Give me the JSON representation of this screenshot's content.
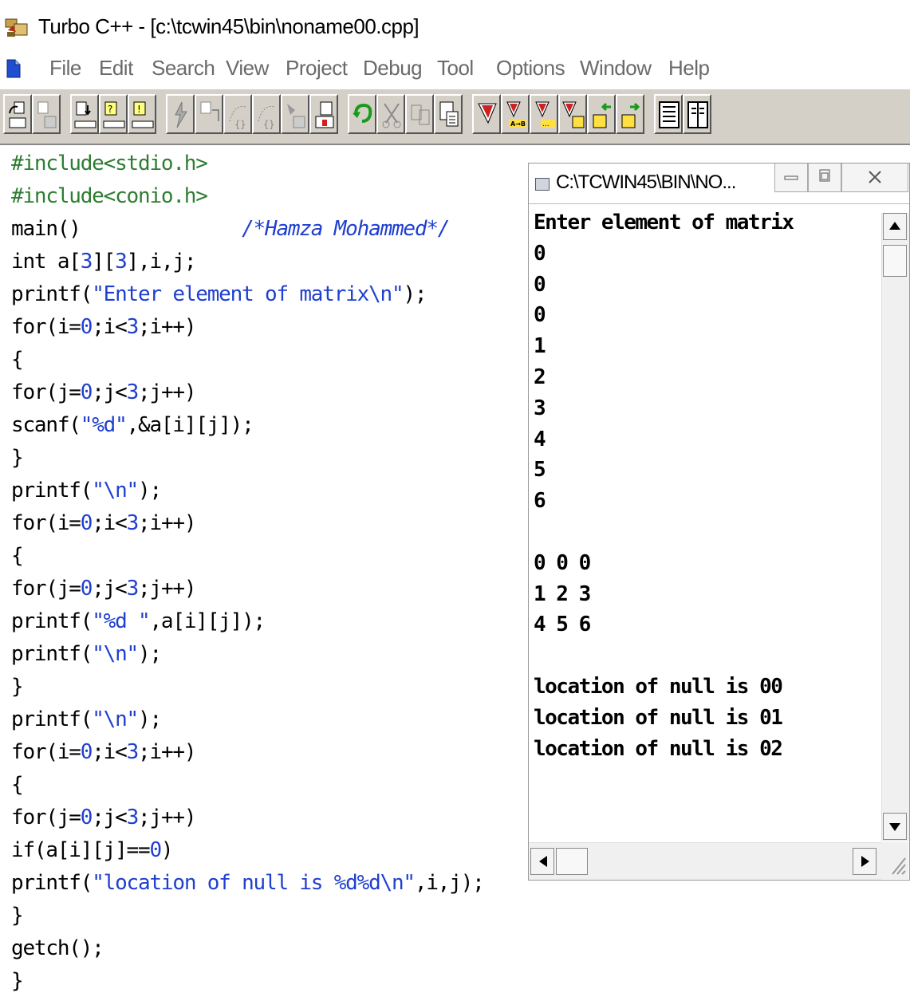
{
  "window": {
    "title": "Turbo C++ - [c:\\tcwin45\\bin\\noname00.cpp]",
    "icon": "turbo-cpp-app-icon"
  },
  "menu": {
    "doc_icon": "document-icon",
    "items": [
      "File",
      "Edit",
      "Search",
      "View",
      "Project",
      "Debug",
      "Tool",
      "Options",
      "Window",
      "Help"
    ]
  },
  "toolbar": {
    "buttons": [
      "open-project-icon",
      "save-project-icon",
      "compile-icon",
      "make-icon",
      "build-icon",
      "run-icon",
      "step-over-icon",
      "trace-into-icon",
      "breakpoint-icon",
      "inspect-icon",
      "undo-icon",
      "cut-icon",
      "copy-icon",
      "paste-icon",
      "search-icon",
      "replace-icon",
      "search-again-icon",
      "browse-icon",
      "previous-icon",
      "next-icon",
      "window-cascade-icon",
      "window-tile-icon"
    ]
  },
  "editor": {
    "lines": [
      [
        {
          "t": "#include<stdio.h>",
          "c": "pp"
        }
      ],
      [
        {
          "t": "#include<conio.h>",
          "c": "pp"
        }
      ],
      [
        {
          "t": "main()",
          "c": ""
        },
        {
          "t": "              /*Hamza Mohammed*/",
          "c": "cmt"
        }
      ],
      [
        {
          "t": "int a[",
          "c": ""
        },
        {
          "t": "3",
          "c": "num"
        },
        {
          "t": "][",
          "c": ""
        },
        {
          "t": "3",
          "c": "num"
        },
        {
          "t": "],i,j;",
          "c": ""
        }
      ],
      [
        {
          "t": "printf(",
          "c": ""
        },
        {
          "t": "\"Enter element of matrix\\n\"",
          "c": "str"
        },
        {
          "t": ");",
          "c": ""
        }
      ],
      [
        {
          "t": "for(i=",
          "c": ""
        },
        {
          "t": "0",
          "c": "num"
        },
        {
          "t": ";i<",
          "c": ""
        },
        {
          "t": "3",
          "c": "num"
        },
        {
          "t": ";i++)",
          "c": ""
        }
      ],
      [
        {
          "t": "{",
          "c": ""
        }
      ],
      [
        {
          "t": "for(j=",
          "c": ""
        },
        {
          "t": "0",
          "c": "num"
        },
        {
          "t": ";j<",
          "c": ""
        },
        {
          "t": "3",
          "c": "num"
        },
        {
          "t": ";j++)",
          "c": ""
        }
      ],
      [
        {
          "t": "scanf(",
          "c": ""
        },
        {
          "t": "\"%d\"",
          "c": "str"
        },
        {
          "t": ",&a[i][j]);",
          "c": ""
        }
      ],
      [
        {
          "t": "}",
          "c": ""
        }
      ],
      [
        {
          "t": "printf(",
          "c": ""
        },
        {
          "t": "\"\\n\"",
          "c": "str"
        },
        {
          "t": ");",
          "c": ""
        }
      ],
      [
        {
          "t": "for(i=",
          "c": ""
        },
        {
          "t": "0",
          "c": "num"
        },
        {
          "t": ";i<",
          "c": ""
        },
        {
          "t": "3",
          "c": "num"
        },
        {
          "t": ";i++)",
          "c": ""
        }
      ],
      [
        {
          "t": "{",
          "c": ""
        }
      ],
      [
        {
          "t": "for(j=",
          "c": ""
        },
        {
          "t": "0",
          "c": "num"
        },
        {
          "t": ";j<",
          "c": ""
        },
        {
          "t": "3",
          "c": "num"
        },
        {
          "t": ";j++)",
          "c": ""
        }
      ],
      [
        {
          "t": "printf(",
          "c": ""
        },
        {
          "t": "\"%d \"",
          "c": "str"
        },
        {
          "t": ",a[i][j]);",
          "c": ""
        }
      ],
      [
        {
          "t": "printf(",
          "c": ""
        },
        {
          "t": "\"\\n\"",
          "c": "str"
        },
        {
          "t": ");",
          "c": ""
        }
      ],
      [
        {
          "t": "}",
          "c": ""
        }
      ],
      [
        {
          "t": "printf(",
          "c": ""
        },
        {
          "t": "\"\\n\"",
          "c": "str"
        },
        {
          "t": ");",
          "c": ""
        }
      ],
      [
        {
          "t": "for(i=",
          "c": ""
        },
        {
          "t": "0",
          "c": "num"
        },
        {
          "t": ";i<",
          "c": ""
        },
        {
          "t": "3",
          "c": "num"
        },
        {
          "t": ";i++)",
          "c": ""
        }
      ],
      [
        {
          "t": "{",
          "c": ""
        }
      ],
      [
        {
          "t": "for(j=",
          "c": ""
        },
        {
          "t": "0",
          "c": "num"
        },
        {
          "t": ";j<",
          "c": ""
        },
        {
          "t": "3",
          "c": "num"
        },
        {
          "t": ";j++)",
          "c": ""
        }
      ],
      [
        {
          "t": "if(a[i][j]==",
          "c": ""
        },
        {
          "t": "0",
          "c": "num"
        },
        {
          "t": ")",
          "c": ""
        }
      ],
      [
        {
          "t": "printf(",
          "c": ""
        },
        {
          "t": "\"location of null is %d%d\\n\"",
          "c": "str"
        },
        {
          "t": ",i,j);",
          "c": ""
        }
      ],
      [
        {
          "t": "}",
          "c": ""
        }
      ],
      [
        {
          "t": "getch();",
          "c": ""
        }
      ],
      [
        {
          "t": "}",
          "c": ""
        }
      ]
    ]
  },
  "console": {
    "title": "C:\\TCWIN45\\BIN\\NO...",
    "output": [
      "Enter element of matrix",
      "0",
      "0",
      "0",
      "1",
      "2",
      "3",
      "4",
      "5",
      "6",
      "",
      "0 0 0",
      "1 2 3",
      "4 5 6",
      "",
      "location of null is 00",
      "location of null is 01",
      "location of null is 02"
    ]
  },
  "colors": {
    "preprocessor": "#2e7d32",
    "string": "#1f3fcf",
    "toolbar_bg": "#d4d0c8"
  }
}
